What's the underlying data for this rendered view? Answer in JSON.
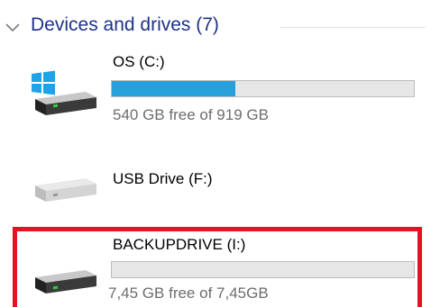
{
  "group": {
    "title": "Devices and drives (7)",
    "icon": "chevron-down-icon"
  },
  "drives": [
    {
      "name": "OS (C:)",
      "info": "540 GB free of 919 GB",
      "used_fraction": 0.41,
      "icon": "windows-drive-icon",
      "bar_color": "#26a0da"
    },
    {
      "name": "USB Drive (F:)",
      "icon": "usb-drive-icon"
    },
    {
      "name": "BACKUPDRIVE (I:)",
      "info": "7,45 GB free of 7,45GB",
      "used_fraction": 0,
      "icon": "hard-drive-icon"
    }
  ],
  "highlight_color": "#e81123"
}
